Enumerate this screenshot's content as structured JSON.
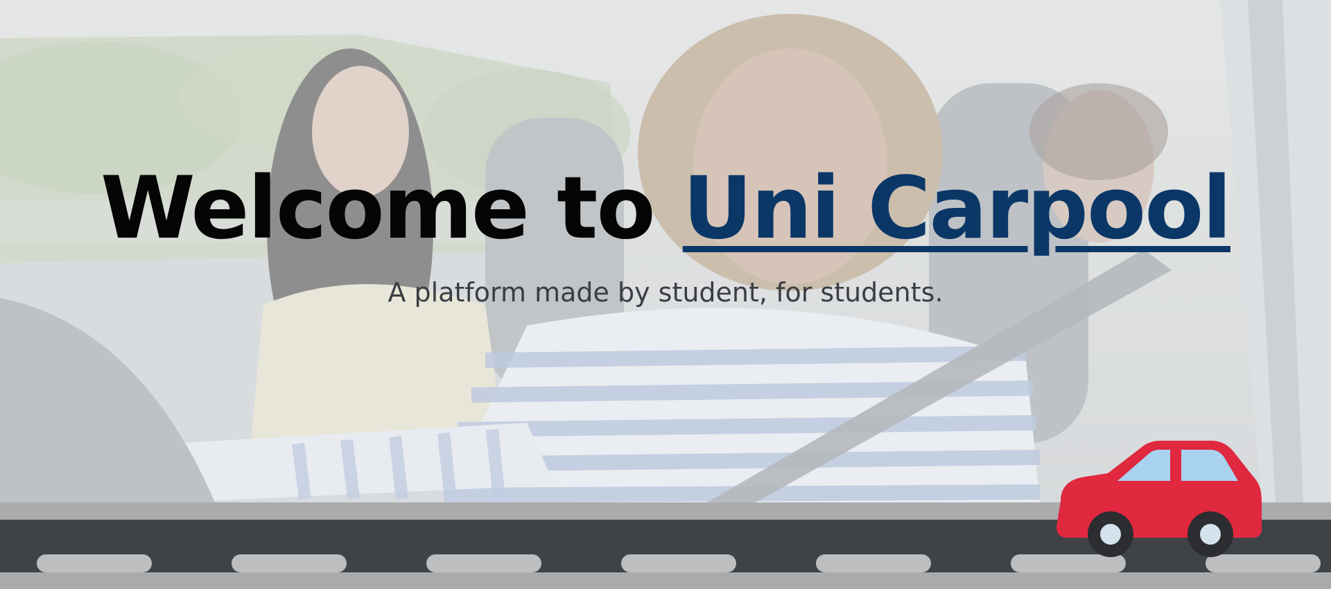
{
  "hero": {
    "title_prefix": "Welcome to ",
    "brand_name": "Uni Carpool",
    "tagline": "A platform made by student, for students."
  },
  "colors": {
    "brand": "#0b3767",
    "headline": "#050505",
    "tagline": "#3a3d42",
    "road_asphalt": "#3f4348",
    "road_shoulder": "#a9abad",
    "lane_dash": "#bcbec0",
    "car_body": "#e0283e",
    "car_window": "#a9d2ee",
    "car_wheel": "#2b2d31"
  },
  "icons": {
    "car": "car-icon"
  }
}
